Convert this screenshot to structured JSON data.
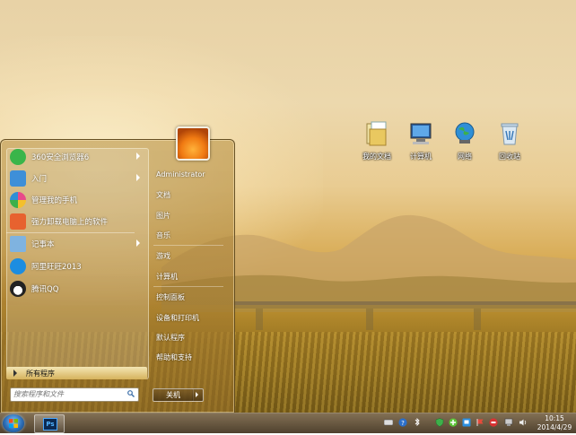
{
  "desktop": {
    "icons": [
      {
        "label": "我的文档",
        "icon": "documents-folder-icon"
      },
      {
        "label": "计算机",
        "icon": "computer-icon"
      },
      {
        "label": "网络",
        "icon": "network-globe-icon"
      },
      {
        "label": "回收站",
        "icon": "recycle-bin-icon"
      }
    ]
  },
  "start_menu": {
    "pinned": [
      {
        "label": "360安全浏览器6",
        "icon": "360-browser-icon",
        "color": "#39b54a",
        "has_arrow": true
      },
      {
        "label": "入门",
        "icon": "getting-started-icon",
        "color": "#3e8fd8",
        "has_arrow": true
      },
      {
        "label": "管理我的手机",
        "icon": "phone-manager-icon",
        "color": "#e84a8a",
        "has_arrow": false
      },
      {
        "label": "强力卸载电脑上的软件",
        "icon": "uninstaller-icon",
        "color": "#e7622f",
        "has_arrow": false
      },
      {
        "label": "记事本",
        "icon": "notepad-icon",
        "color": "#7fb3e0",
        "has_arrow": true
      },
      {
        "label": "阿里旺旺2013",
        "icon": "aliwangwang-icon",
        "color": "#1c8de0",
        "has_arrow": false
      },
      {
        "label": "腾讯QQ",
        "icon": "qq-penguin-icon",
        "color": "#222222",
        "has_arrow": false
      }
    ],
    "all_programs": "所有程序",
    "search_placeholder": "搜索程序和文件",
    "right_items": {
      "user": "Administrator",
      "documents": "文档",
      "pictures": "图片",
      "music": "音乐",
      "games": "游戏",
      "computer": "计算机",
      "control_panel": "控制面板",
      "devices_printers": "设备和打印机",
      "default_programs": "默认程序",
      "help_support": "帮助和支持"
    },
    "shutdown_label": "关机"
  },
  "taskbar": {
    "pinned_app": "Ps",
    "clock_time": "10:15",
    "clock_date": "2014/4/29",
    "tray_icons": [
      "keyboard-icon",
      "help-icon",
      "bluetooth-icon",
      "security-shield-icon",
      "green-plus-icon",
      "network-icon",
      "flag-icon",
      "stop-icon",
      "network-monitor-icon",
      "volume-icon"
    ]
  }
}
